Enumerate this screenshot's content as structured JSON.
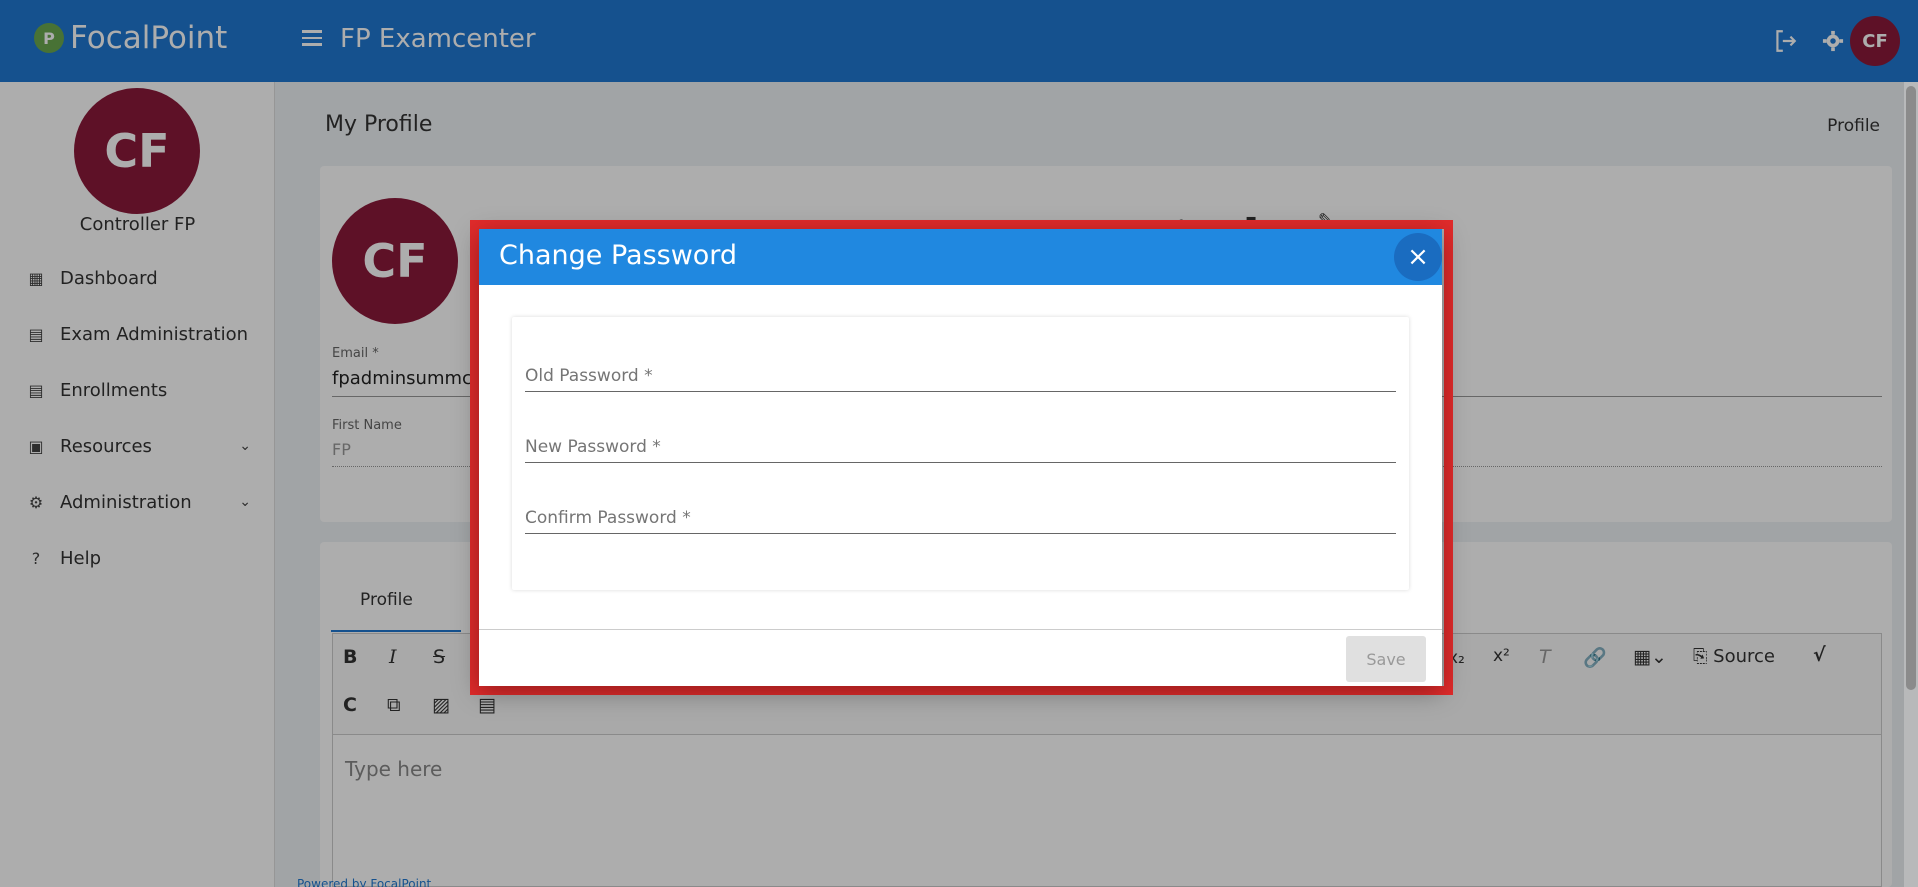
{
  "topbar": {
    "brand": "FocalPoint",
    "brand_logo": "P",
    "app_title": "FP Examcenter",
    "avatar_initials": "CF"
  },
  "sidebar": {
    "avatar_initials": "CF",
    "user_name": "Controller FP",
    "items": [
      {
        "label": "Dashboard",
        "icon": "dashboard-icon"
      },
      {
        "label": "Exam Administration",
        "icon": "library-books-icon"
      },
      {
        "label": "Enrollments",
        "icon": "library-books-icon"
      },
      {
        "label": "Resources",
        "icon": "clipboard-icon"
      },
      {
        "label": "Administration",
        "icon": "gear-icon"
      },
      {
        "label": "Help",
        "icon": "help-icon"
      }
    ]
  },
  "main": {
    "page_title": "My Profile",
    "breadcrumb": "Profile",
    "avatar_initials": "CF",
    "email_label": "Email *",
    "email_value": "fpadminsummc",
    "first_name_label": "First Name",
    "first_name_value": "FP",
    "tab_label": "Profile",
    "source_label": "Source",
    "editor_placeholder": "Type here",
    "footer": "Powered by FocalPoint"
  },
  "modal": {
    "title": "Change Password",
    "old_password_placeholder": "Old Password *",
    "new_password_placeholder": "New Password *",
    "confirm_password_placeholder": "Confirm Password *",
    "save_label": "Save"
  },
  "colors": {
    "primary": "#1f78d1",
    "modal_header": "#2088e0",
    "avatar": "#8b1a3a",
    "highlight": "#e12b2b"
  }
}
